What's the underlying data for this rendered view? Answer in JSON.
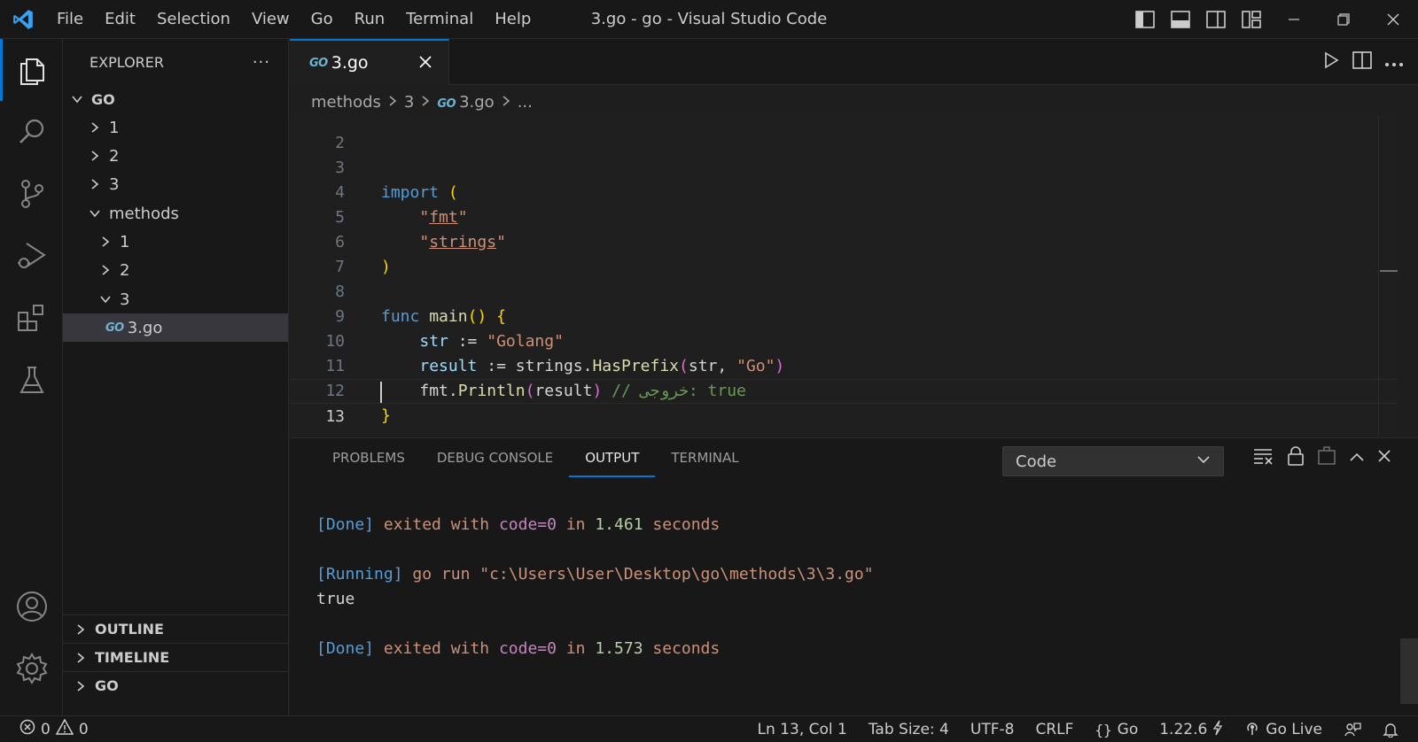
{
  "window": {
    "title": "3.go - go - Visual Studio Code",
    "menu": [
      "File",
      "Edit",
      "Selection",
      "View",
      "Go",
      "Run",
      "Terminal",
      "Help"
    ]
  },
  "sidebar": {
    "title": "EXPLORER",
    "more": "···",
    "root": "GO",
    "tree": [
      {
        "label": "1",
        "type": "folder",
        "expanded": false,
        "depth": 1
      },
      {
        "label": "2",
        "type": "folder",
        "expanded": false,
        "depth": 1
      },
      {
        "label": "3",
        "type": "folder",
        "expanded": false,
        "depth": 1
      },
      {
        "label": "methods",
        "type": "folder",
        "expanded": true,
        "depth": 1
      },
      {
        "label": "1",
        "type": "folder",
        "expanded": false,
        "depth": 2
      },
      {
        "label": "2",
        "type": "folder",
        "expanded": false,
        "depth": 2
      },
      {
        "label": "3",
        "type": "folder",
        "expanded": true,
        "depth": 2
      },
      {
        "label": "3.go",
        "type": "file",
        "selected": true,
        "depth": 3
      }
    ],
    "sections": [
      "OUTLINE",
      "TIMELINE",
      "GO"
    ]
  },
  "editor": {
    "tab_label": "3.go",
    "file_icon_text": "GO",
    "breadcrumbs": [
      "methods",
      "3",
      "3.go",
      "..."
    ],
    "lines": {
      "l2": "2",
      "l3": "3",
      "l4": "4",
      "l5": "5",
      "l6": "6",
      "l7": "7",
      "l8": "8",
      "l9": "9",
      "l10": "10",
      "l11": "11",
      "l12": "12",
      "l13": "13"
    },
    "code": {
      "import_kw": "import",
      "open_paren": "(",
      "fmt_pkg": "fmt",
      "strings_pkg": "strings",
      "close_paren": ")",
      "func_kw": "func",
      "main_fn": "main",
      "main_parens": "()",
      "open_brace": "{",
      "str_var": "str",
      "assign": ":=",
      "golang_str": "\"Golang\"",
      "result_var": "result",
      "strings_obj": "strings.",
      "hasprefix_fn": "HasPrefix",
      "call_args_str": "str",
      "comma": ", ",
      "go_str": "\"Go\"",
      "fmt_obj": "fmt.",
      "println_fn": "Println",
      "println_arg": "result",
      "comment": "// خروجی: true",
      "close_brace": "}"
    }
  },
  "panel": {
    "tabs": [
      "PROBLEMS",
      "DEBUG CONSOLE",
      "OUTPUT",
      "TERMINAL"
    ],
    "active_tab": "OUTPUT",
    "channel": "Code",
    "output": {
      "done1": {
        "tag": "[Done]",
        "text1": "exited with",
        "code": "code=0",
        "text2": "in",
        "time": "1.461",
        "text3": "seconds"
      },
      "running": {
        "tag": "[Running]",
        "cmd": "go run \"c:\\Users\\User\\Desktop\\go\\methods\\3\\3.go\""
      },
      "result": "true",
      "done2": {
        "tag": "[Done]",
        "text1": "exited with",
        "code": "code=0",
        "text2": "in",
        "time": "1.573",
        "text3": "seconds"
      }
    }
  },
  "status": {
    "errors": "0",
    "warnings": "0",
    "position": "Ln 13, Col 1",
    "tab_size": "Tab Size: 4",
    "encoding": "UTF-8",
    "eol": "CRLF",
    "language": "Go",
    "go_version": "1.22.6",
    "go_live": "Go Live"
  },
  "colors": {
    "accent": "#0078d4",
    "background": "#1e1e1e",
    "keyword": "#569cd6",
    "string": "#ce9178",
    "function": "#dcdcaa",
    "comment": "#6a9955"
  }
}
